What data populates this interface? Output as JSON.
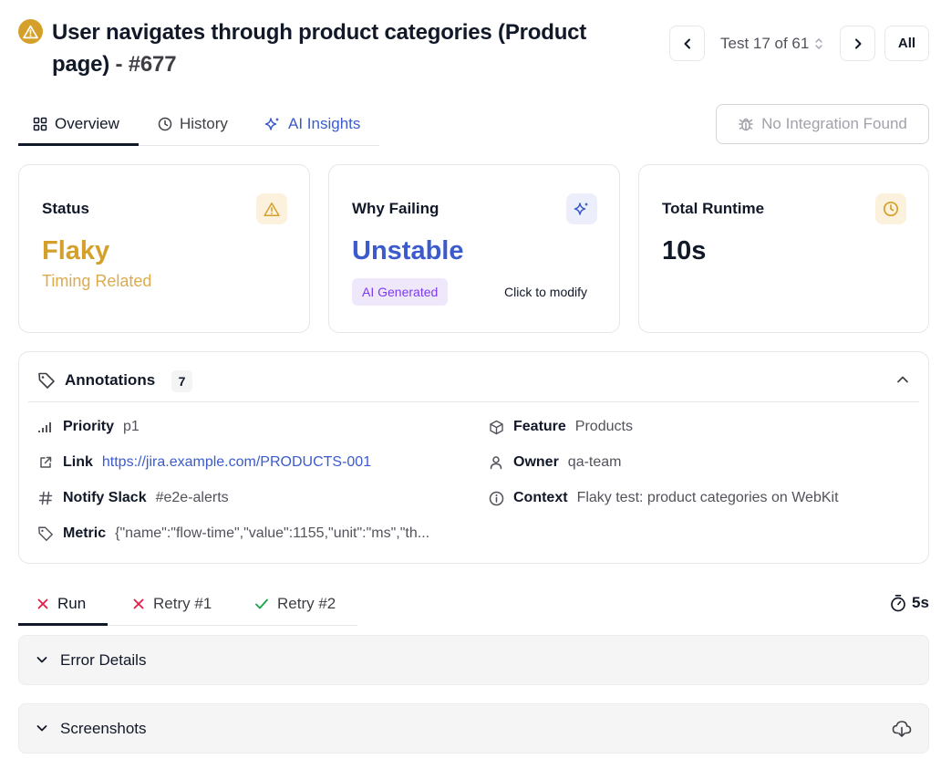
{
  "header": {
    "title": "User navigates through product categories (Product page)",
    "number": "- #677",
    "test_counter": "Test 17 of 61",
    "all_label": "All"
  },
  "tabs": [
    {
      "label": "Overview"
    },
    {
      "label": "History"
    },
    {
      "label": "AI Insights"
    }
  ],
  "integration_label": "No Integration Found",
  "cards": {
    "status": {
      "label": "Status",
      "value": "Flaky",
      "sub": "Timing Related"
    },
    "why": {
      "label": "Why Failing",
      "value": "Unstable",
      "badge": "AI Generated",
      "action": "Click to modify"
    },
    "runtime": {
      "label": "Total Runtime",
      "value": "10s"
    }
  },
  "annotations": {
    "title": "Annotations",
    "count": "7",
    "items": [
      {
        "key": "Priority",
        "value": "p1"
      },
      {
        "key": "Link",
        "value": "https://jira.example.com/PRODUCTS-001"
      },
      {
        "key": "Notify Slack",
        "value": "#e2e-alerts"
      },
      {
        "key": "Metric",
        "value": "{\"name\":\"flow-time\",\"value\":1155,\"unit\":\"ms\",\"th..."
      },
      {
        "key": "Feature",
        "value": "Products"
      },
      {
        "key": "Owner",
        "value": "qa-team"
      },
      {
        "key": "Context",
        "value": "Flaky test: product categories on WebKit"
      }
    ]
  },
  "run_tabs": [
    {
      "label": "Run",
      "status": "failed"
    },
    {
      "label": "Retry #1",
      "status": "failed"
    },
    {
      "label": "Retry #2",
      "status": "passed"
    }
  ],
  "duration": "5s",
  "sections": [
    {
      "label": "Error Details"
    },
    {
      "label": "Screenshots"
    }
  ],
  "colors": {
    "flaky": "#d4a02a",
    "unstable": "#3b5bcc",
    "fail": "#e11d48",
    "pass": "#16a34a",
    "ai_badge": "#7c3aed"
  }
}
